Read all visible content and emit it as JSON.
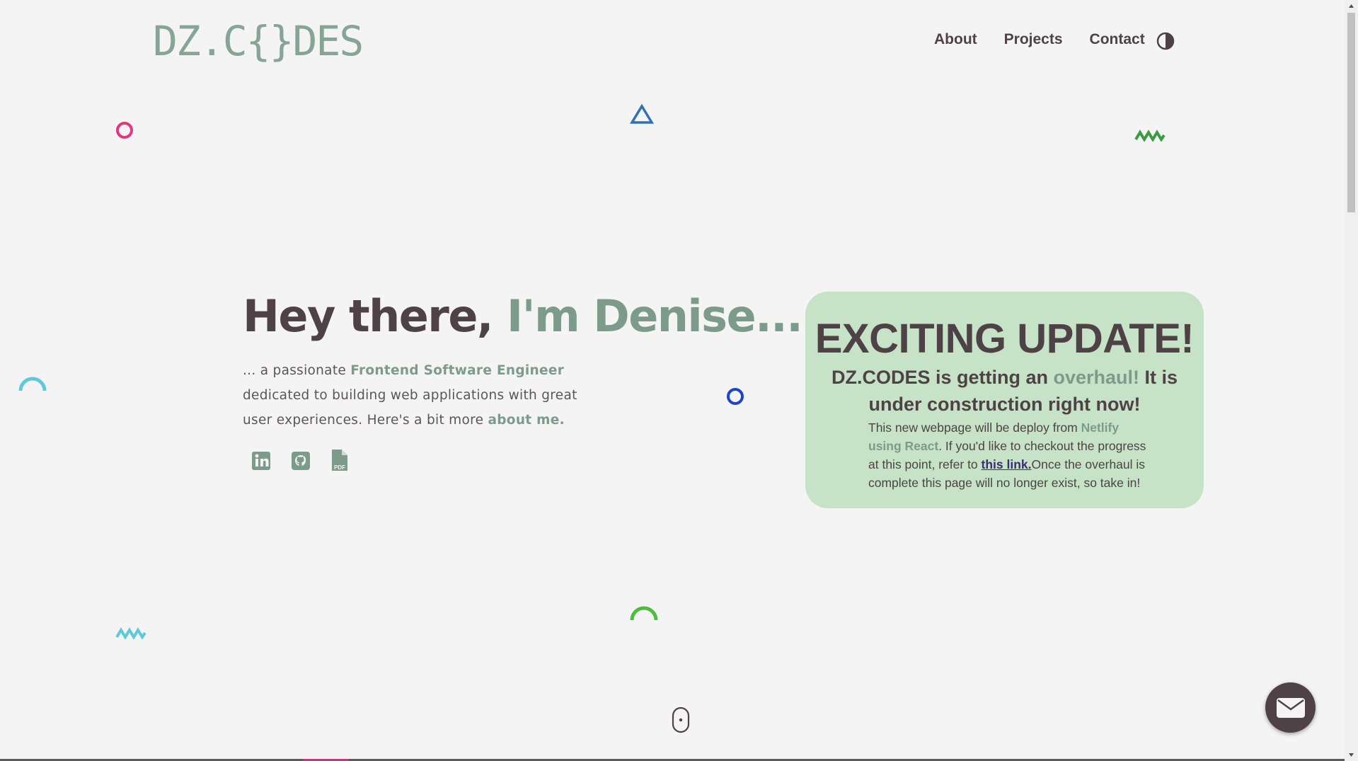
{
  "header": {
    "logo_text": "DZ.C{}DES",
    "nav": [
      {
        "label": "About"
      },
      {
        "label": "Projects"
      },
      {
        "label": "Contact"
      }
    ],
    "theme_toggle_icon": "contrast-icon"
  },
  "hero": {
    "title_lead": "Hey there, ",
    "title_accent": "I'm Denise...",
    "intro_1": "... a passionate ",
    "intro_role": "Frontend Software Engineer",
    "intro_2": " dedicated to building web applications with great user experiences. Here's a bit more ",
    "intro_link": "about me",
    "intro_end": ".",
    "socials": [
      {
        "icon": "linkedin-icon"
      },
      {
        "icon": "github-icon"
      },
      {
        "icon": "pdf-icon"
      }
    ]
  },
  "update_card": {
    "heading": "EXCITING UPDATE!",
    "sub_1": "DZ.CODES is getting an ",
    "sub_accent": "overhaul!",
    "sub_2": " It is under construction right now!",
    "body_1": "This new webpage will be deploy from ",
    "body_bold": "Netlify using React",
    "body_2": ". If you'd like to checkout the progress at this point, refer to ",
    "body_link": "this link.",
    "body_3": "Once the overhaul is complete this page will no longer exist, so take in!"
  },
  "colors": {
    "background": "#f4f4f4",
    "text_dark": "#4e4246",
    "accent_green": "#7c9b8a",
    "card_bg": "#c6e3c7",
    "link": "#3d2a7a"
  },
  "decorations": [
    "ring-pink",
    "triangle-blue",
    "zigzag-green",
    "arc-cyan",
    "ring-blue",
    "triangle-teal",
    "zigzag-cyan",
    "arc-green"
  ],
  "scroll_hint_icon": "mouse-scroll-icon",
  "mail_button_icon": "envelope-icon"
}
